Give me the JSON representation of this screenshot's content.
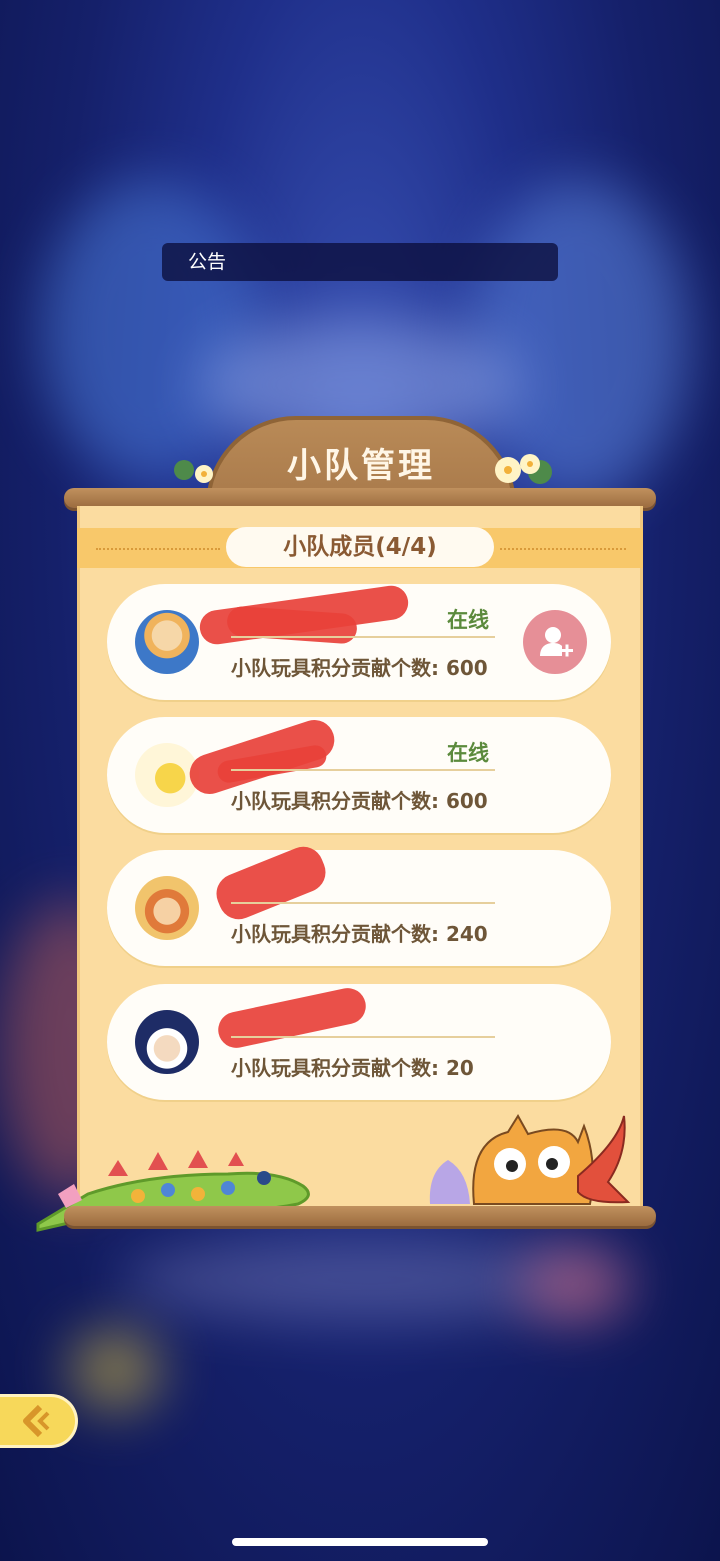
{
  "announcement": {
    "label": "公告"
  },
  "board": {
    "title": "小队管理",
    "subtitle": "小队成员(4/4)"
  },
  "members": [
    {
      "status": "在线",
      "contribution": "小队玩具积分贡献个数: 600",
      "avatar": "girl-blue-hat-avatar"
    },
    {
      "status": "在线",
      "contribution": "小队玩具积分贡献个数: 600",
      "avatar": "yellow-bear-avatar"
    },
    {
      "status": "",
      "contribution": "小队玩具积分贡献个数: 240",
      "avatar": "girl-orange-hat-avatar"
    },
    {
      "status": "",
      "contribution": "小队玩具积分贡献个数: 20",
      "avatar": "boy-navy-avatar"
    }
  ],
  "colors": {
    "status_online": "#5b8a3c",
    "add_button": "#e68f97",
    "panel": "#fbdca0",
    "back_button": "#f7d85a"
  }
}
